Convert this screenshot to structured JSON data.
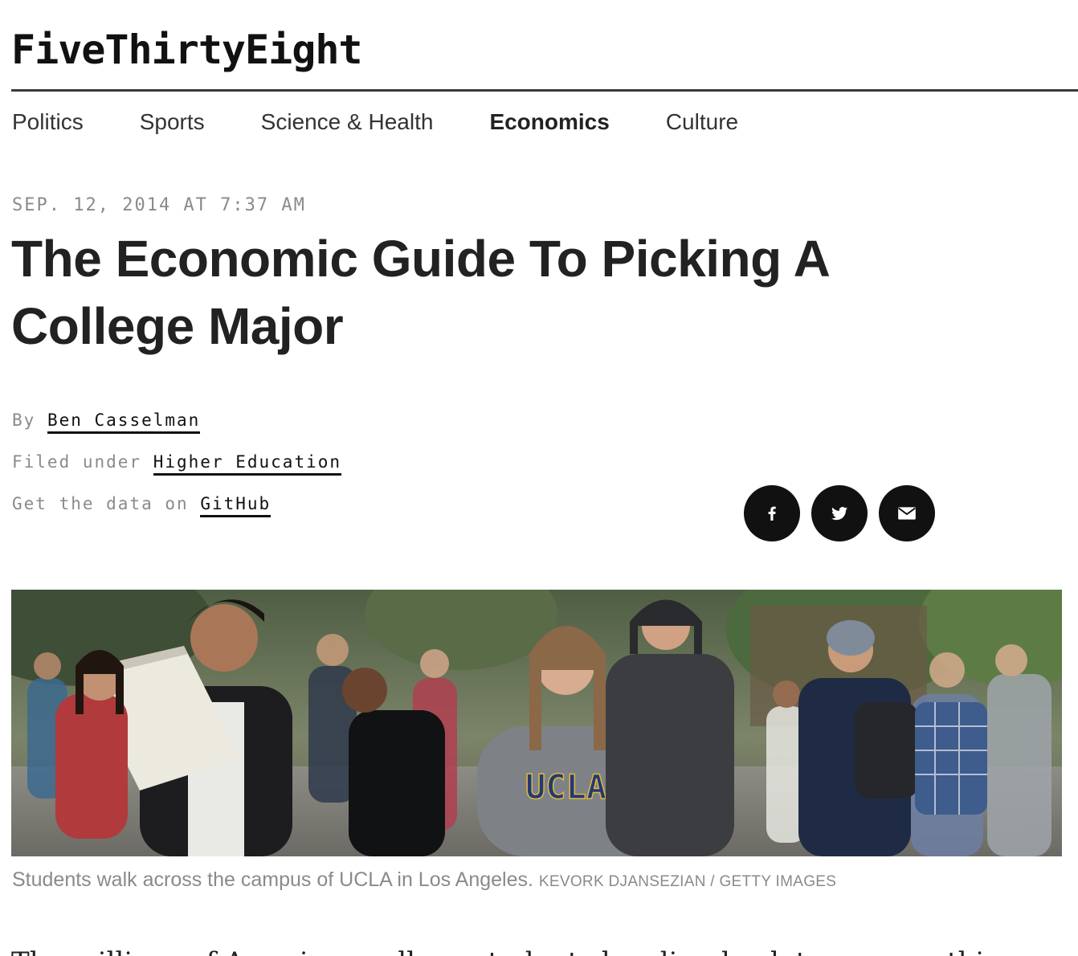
{
  "site": {
    "logo": "FiveThirtyEight"
  },
  "nav": {
    "items": [
      {
        "label": "Politics",
        "active": false
      },
      {
        "label": "Sports",
        "active": false
      },
      {
        "label": "Science & Health",
        "active": false
      },
      {
        "label": "Economics",
        "active": true
      },
      {
        "label": "Culture",
        "active": false
      }
    ]
  },
  "article": {
    "dateline": "SEP. 12, 2014 AT 7:37 AM",
    "headline": "The Economic Guide To Picking A College Major",
    "byline_prefix": "By",
    "author": "Ben Casselman",
    "filed_prefix": "Filed under",
    "topic": "Higher Education",
    "data_prefix": "Get the data on",
    "data_link": "GitHub",
    "caption": "Students walk across the campus of UCLA in Los Angeles.",
    "credit": "KEVORK DJANSEZIAN / GETTY IMAGES",
    "body_start": "The millions of American college students heading back to campus this"
  },
  "share": {
    "buttons": [
      "facebook-icon",
      "twitter-icon",
      "email-icon"
    ]
  },
  "colors": {
    "text": "#222222",
    "muted": "#8a8a8a",
    "share_bg": "#111111"
  }
}
